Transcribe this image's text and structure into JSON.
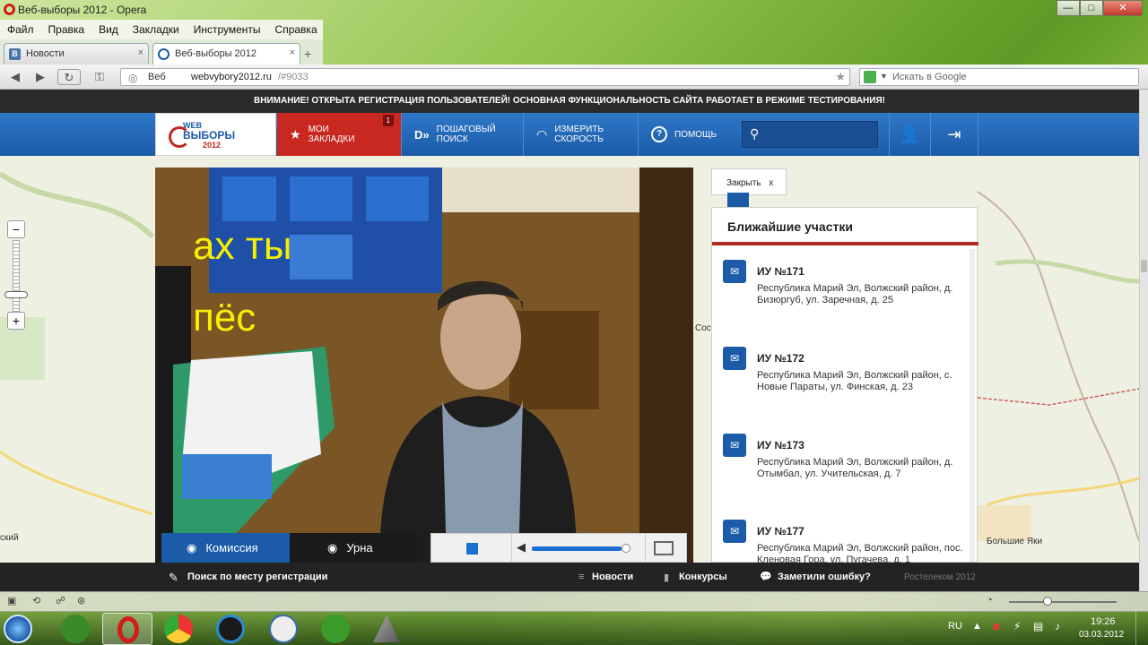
{
  "window": {
    "title": "Веб-выборы 2012 - Opera",
    "buttons": {
      "minimize": "—",
      "maximize": "□",
      "close": "✕"
    }
  },
  "menu": [
    "Файл",
    "Правка",
    "Вид",
    "Закладки",
    "Инструменты",
    "Справка"
  ],
  "tabs": [
    {
      "label": "Новости",
      "close": "×"
    },
    {
      "label": "Веб-выборы 2012",
      "close": "×"
    }
  ],
  "address": {
    "mode": "Веб",
    "url": "webvybory2012.ru",
    "hash": "/#9033",
    "search_placeholder": "Искать в Google"
  },
  "site": {
    "notice": "ВНИМАНИЕ! ОТКРЫТА РЕГИСТРАЦИЯ ПОЛЬЗОВАТЕЛЕЙ! ОСНОВНАЯ ФУНКЦИОНАЛЬНОСТЬ САЙТА РАБОТАЕТ В РЕЖИМЕ ТЕСТИРОВАНИЯ!",
    "logo": {
      "line1": "WEB",
      "line2": "ВЫБОРЫ",
      "line3": "2012"
    },
    "nav": {
      "bookmarks": "МОИ ЗАКЛАДКИ",
      "bookmarks_count": "1",
      "step_search": "ПОШАГОВЫЙ ПОИСК",
      "speed": "ИЗМЕРИТЬ СКОРОСТЬ",
      "help": "ПОМОЩЬ"
    }
  },
  "map": {
    "zoom_in": "+",
    "zoom_out": "−",
    "labels": {
      "left": "ский",
      "right": "Большие Яки",
      "mid": "Сос"
    }
  },
  "video": {
    "overlay_line1": "ах ты",
    "overlay_line2": "пёс",
    "controls": {
      "commission": "Комиссия",
      "urn": "Урна"
    }
  },
  "panel": {
    "close": "Закрыть",
    "close_x": "x",
    "title": "Ближайшие участки",
    "items": [
      {
        "name": "ИУ №171",
        "address": "Республика Марий Эл, Волжский район, д. Бизюргуб, ул. Заречная, д. 25"
      },
      {
        "name": "ИУ №172",
        "address": "Республика Марий Эл, Волжский район, с. Новые Параты, ул. Финская, д. 23"
      },
      {
        "name": "ИУ №173",
        "address": "Республика Марий Эл, Волжский район, д. Отымбал, ул. Учительская, д. 7"
      },
      {
        "name": "ИУ №177",
        "address": "Республика Марий Эл, Волжский район, пос. Кленовая Гора, ул. Пугачева, д. 1"
      }
    ]
  },
  "bottom": {
    "search_reg": "Поиск по месту регистрации",
    "news": "Новости",
    "contests": "Конкурсы",
    "feedback": "Заметили ошибку?",
    "copyright": "Ростелеком 2012"
  },
  "tray": {
    "lang": "RU",
    "time": "19:26",
    "date": "03.03.2012"
  }
}
